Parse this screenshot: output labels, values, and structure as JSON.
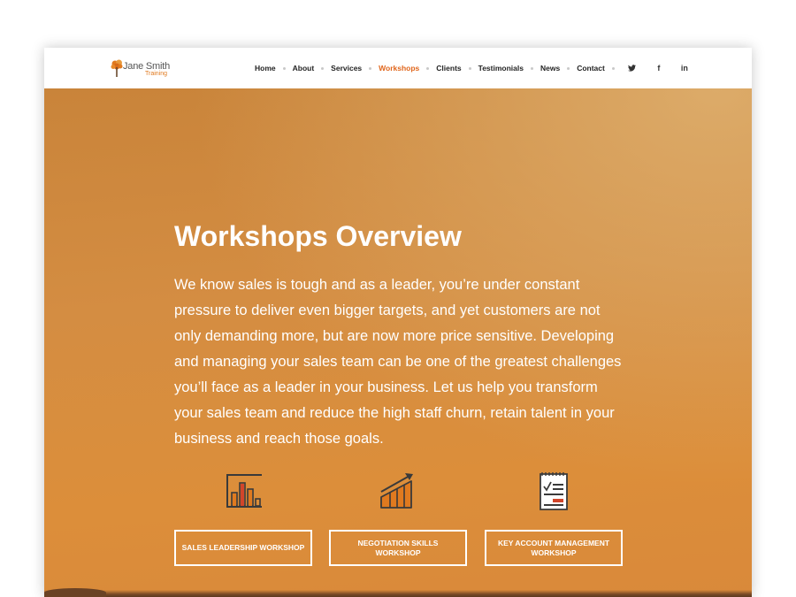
{
  "brand": {
    "name": "Jane Smith",
    "sub": "Training"
  },
  "nav": {
    "items": [
      {
        "label": "Home",
        "active": false
      },
      {
        "label": "About",
        "active": false
      },
      {
        "label": "Services",
        "active": false
      },
      {
        "label": "Workshops",
        "active": true
      },
      {
        "label": "Clients",
        "active": false
      },
      {
        "label": "Testimonials",
        "active": false
      },
      {
        "label": "News",
        "active": false
      },
      {
        "label": "Contact",
        "active": false
      }
    ],
    "social": [
      {
        "icon": "twitter-icon",
        "glyph": "🐦"
      },
      {
        "icon": "facebook-icon",
        "glyph": "f"
      },
      {
        "icon": "linkedin-icon",
        "glyph": "in"
      }
    ]
  },
  "hero": {
    "title": "Workshops Overview",
    "intro": "We know sales is tough and as a leader, you’re under constant pressure to deliver even bigger targets, and yet customers are not only demanding more, but are now more price sensitive. Developing and managing your sales team can be one of the greatest challenges you’ll face as a leader in your business. Let us help you transform your sales team and reduce the high staff churn, retain talent in your business and reach those goals."
  },
  "workshops": [
    {
      "icon": "bar-chart-icon",
      "label": "SALES LEADERSHIP WORKSHOP"
    },
    {
      "icon": "growth-arrow-icon",
      "label": "NEGOTIATION SKILLS WORKSHOP"
    },
    {
      "icon": "checklist-icon",
      "label": "KEY ACCOUNT MANAGEMENT WORKSHOP"
    }
  ],
  "colors": {
    "accent": "#e0661c",
    "hero_orange": "#d58b3f",
    "icon_dark": "#3a3a3a",
    "icon_orange": "#e07a1f",
    "icon_red": "#d2452a"
  }
}
